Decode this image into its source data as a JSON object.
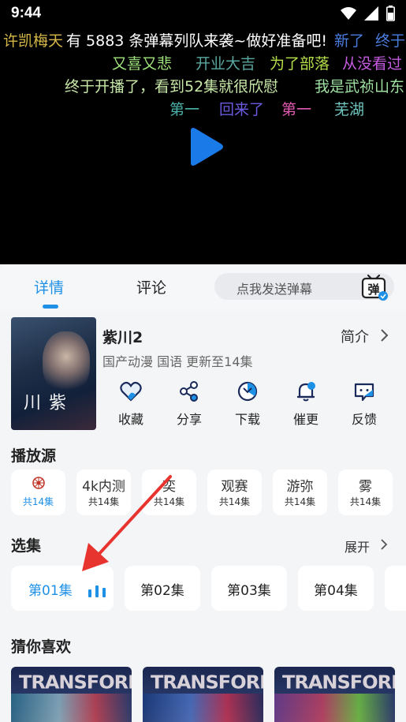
{
  "status_bar": {
    "time": "9:44"
  },
  "player": {
    "danmaku_notice": "有 5883 条弹幕列队来袭~做好准备吧!",
    "danmaku": [
      {
        "text": "许凯梅天",
        "color": "#d7b84a"
      },
      {
        "text": "新了",
        "color": "#4a7de0"
      },
      {
        "text": "终于",
        "color": "#4a7de0"
      },
      {
        "text": "又喜又悲",
        "color": "#9ee07a"
      },
      {
        "text": "开业大吉",
        "color": "#5ba8a0"
      },
      {
        "text": "为了部落",
        "color": "#b6e04a"
      },
      {
        "text": "从没看过",
        "color": "#c45be0"
      },
      {
        "text": "终于开播了，看到52集就很欣慰",
        "color": "#c8e8a8"
      },
      {
        "text": "我是武祯山东",
        "color": "#9ee0a0"
      },
      {
        "text": "第一",
        "color": "#4ab0a8"
      },
      {
        "text": "回来了",
        "color": "#6a5ae0"
      },
      {
        "text": "第一",
        "color": "#e05ab0"
      },
      {
        "text": "芜湖",
        "color": "#70c8c0"
      }
    ]
  },
  "tabs": {
    "details": "详情",
    "comments": "评论"
  },
  "send_danmaku": {
    "placeholder": "点我发送弹幕",
    "icon_glyph": "弹"
  },
  "show": {
    "poster_title": "紫川",
    "title": "紫川2",
    "meta": "国产动漫 国语 更新至14集",
    "intro_label": "简介"
  },
  "actions": [
    {
      "label": "收藏",
      "icon": "heart-icon"
    },
    {
      "label": "分享",
      "icon": "share-icon"
    },
    {
      "label": "下载",
      "icon": "download-icon"
    },
    {
      "label": "催更",
      "icon": "bell-icon"
    },
    {
      "label": "反馈",
      "icon": "feedback-icon"
    }
  ],
  "sources_section": {
    "title": "播放源",
    "items": [
      {
        "name": "",
        "count": "共14集",
        "active": true
      },
      {
        "name": "4k内测",
        "count": "共14集"
      },
      {
        "name": "奕",
        "count": "共14集"
      },
      {
        "name": "观赛",
        "count": "共14集"
      },
      {
        "name": "游弥",
        "count": "共14集"
      },
      {
        "name": "雾",
        "count": "共14集"
      }
    ]
  },
  "episodes_section": {
    "title": "选集",
    "expand_label": "展开",
    "items": [
      "第01集",
      "第02集",
      "第03集",
      "第04集"
    ]
  },
  "recommend_section": {
    "title": "猜你喜欢",
    "logo_text": "TRANSFORMERS"
  },
  "colors": {
    "accent": "#1e90e6",
    "play": "#1a7ae8"
  }
}
